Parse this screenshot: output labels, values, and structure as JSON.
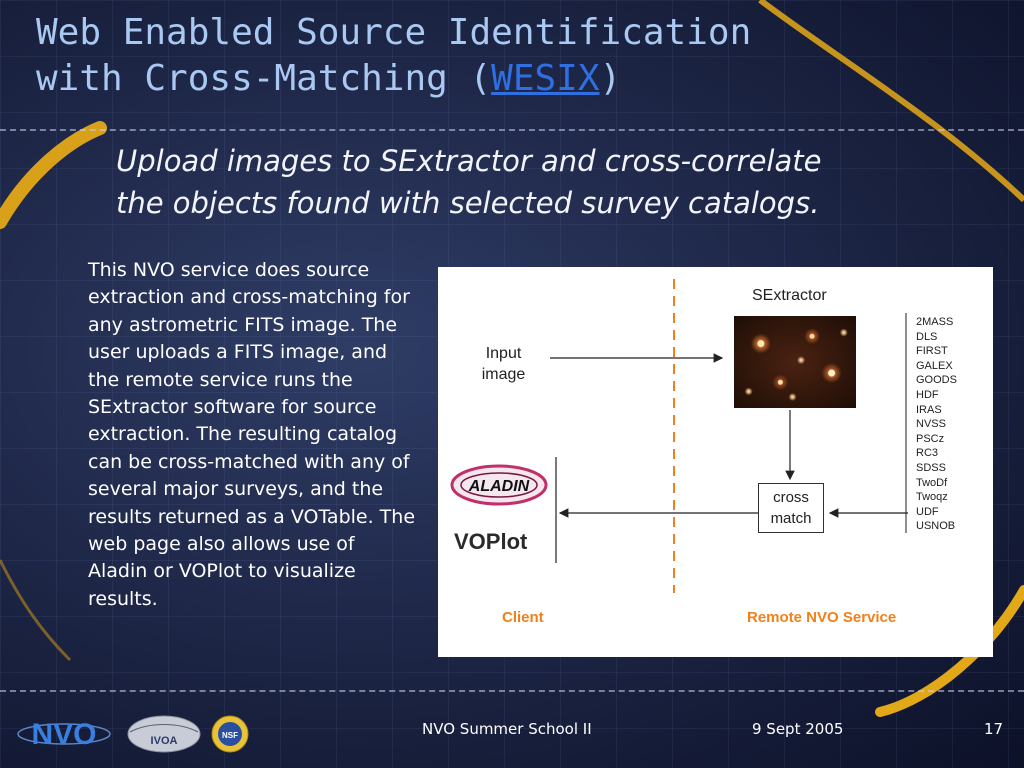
{
  "slide": {
    "title_line1": "Web Enabled Source Identification",
    "title_line2_prefix": "with Cross-Matching (",
    "title_link": "WESIX",
    "title_line2_suffix": ")",
    "subtitle_line1": "Upload images to SExtractor and cross-correlate",
    "subtitle_line2": "the objects found with selected survey catalogs.",
    "description": "This NVO service does source extraction and cross-matching for any astrometric FITS image. The user uploads a FITS image, and the remote service runs the SExtractor software for source extraction.  The resulting catalog can be cross-matched with any of several major surveys, and the results returned as a VOTable. The web page also allows use of Aladin or VOPlot to visualize results."
  },
  "diagram": {
    "input_line1": "Input",
    "input_line2": "image",
    "sextractor_label": "SExtractor",
    "catalogs": [
      "2MASS",
      "DLS",
      "FIRST",
      "GALEX",
      "GOODS",
      "HDF",
      "IRAS",
      "NVSS",
      "PSCz",
      "RC3",
      "SDSS",
      "TwoDf",
      "Twoqz",
      "UDF",
      "USNOB"
    ],
    "cross_line1": "cross",
    "cross_line2": "match",
    "aladin_logo_text": "ALADIN",
    "voplot_label": "VOPlot",
    "client_label": "Client",
    "remote_label": "Remote NVO Service"
  },
  "footer": {
    "event": "NVO Summer School II",
    "date": "9 Sept 2005",
    "page": "17",
    "logo_nvo_text": "NVO",
    "logo_ivoa_text": "IVOA",
    "logo_nsf_text": "NSF"
  },
  "colors": {
    "title": "#a9c8f2",
    "link": "#2f6fe0",
    "accent_orange": "#f0801a",
    "swoosh_gold": "#d9a11a"
  }
}
